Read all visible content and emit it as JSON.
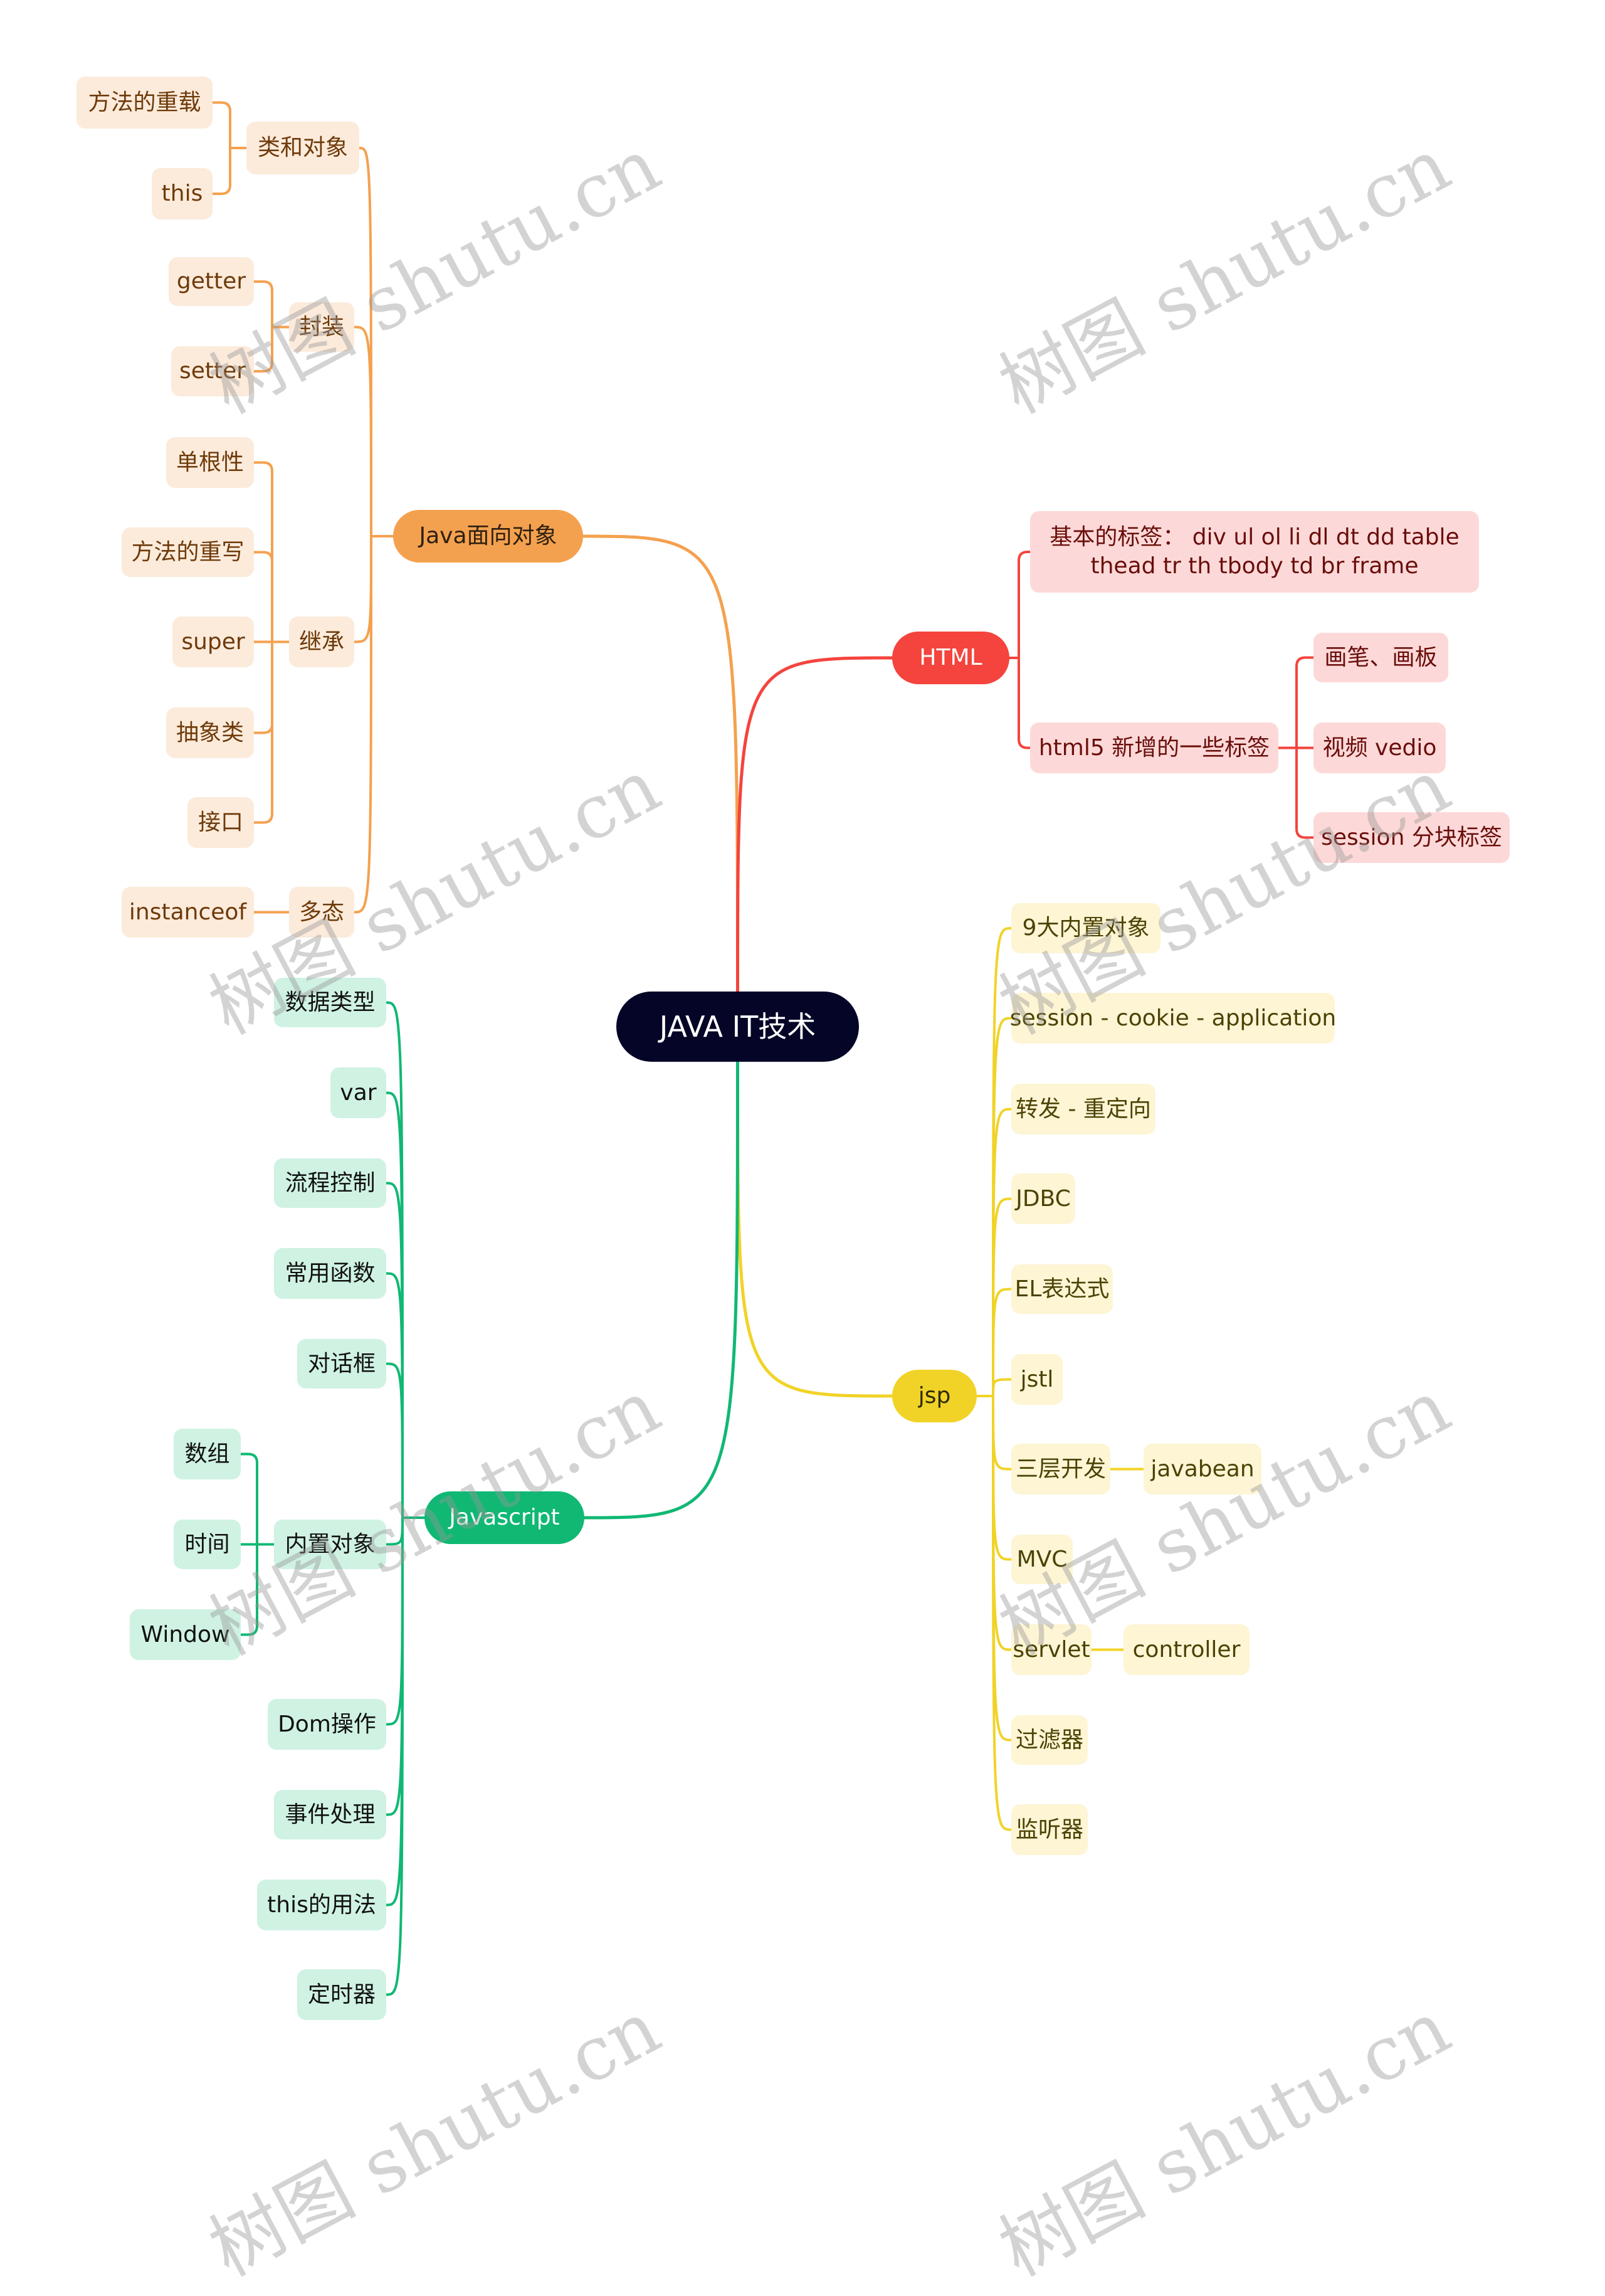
{
  "root": {
    "label": "JAVA IT技术"
  },
  "colors": {
    "root_bg": "#050527",
    "orange": "#f4a14f",
    "red": "#f4443d",
    "yellow": "#f1d327",
    "green": "#10b874"
  },
  "branches": {
    "java_oo": {
      "label": "Java面向对象",
      "children": [
        {
          "label": "类和对象",
          "children": [
            {
              "label": "方法的重载"
            },
            {
              "label": "this"
            }
          ]
        },
        {
          "label": "封装",
          "children": [
            {
              "label": "getter"
            },
            {
              "label": "setter"
            }
          ]
        },
        {
          "label": "继承",
          "children": [
            {
              "label": "单根性"
            },
            {
              "label": "方法的重写"
            },
            {
              "label": "super"
            },
            {
              "label": "抽象类"
            },
            {
              "label": "接口"
            }
          ]
        },
        {
          "label": "多态",
          "children": [
            {
              "label": "instanceof"
            }
          ]
        }
      ]
    },
    "html": {
      "label": "HTML",
      "children": [
        {
          "label": "基本的标签： div ul ol li dl dt dd table thead tr th tbody td br frame"
        },
        {
          "label": "html5 新增的一些标签",
          "children": [
            {
              "label": "画笔、画板"
            },
            {
              "label": "视频 vedio"
            },
            {
              "label": "session 分块标签"
            }
          ]
        }
      ]
    },
    "jsp": {
      "label": "jsp",
      "children": [
        {
          "label": "9大内置对象"
        },
        {
          "label": "session - cookie - application"
        },
        {
          "label": "转发 - 重定向"
        },
        {
          "label": "JDBC"
        },
        {
          "label": "EL表达式"
        },
        {
          "label": "jstl"
        },
        {
          "label": "三层开发",
          "children": [
            {
              "label": "javabean"
            }
          ]
        },
        {
          "label": "MVC"
        },
        {
          "label": "servlet",
          "children": [
            {
              "label": "controller"
            }
          ]
        },
        {
          "label": "过滤器"
        },
        {
          "label": "监听器"
        }
      ]
    },
    "javascript": {
      "label": "Javascript",
      "children": [
        {
          "label": "数据类型"
        },
        {
          "label": "var"
        },
        {
          "label": "流程控制"
        },
        {
          "label": "常用函数"
        },
        {
          "label": "对话框"
        },
        {
          "label": "内置对象",
          "children": [
            {
              "label": "数组"
            },
            {
              "label": "时间"
            },
            {
              "label": "Window"
            }
          ]
        },
        {
          "label": "Dom操作"
        },
        {
          "label": "事件处理"
        },
        {
          "label": "this的用法"
        },
        {
          "label": "定时器"
        }
      ]
    }
  },
  "watermark": {
    "text": "树图 shutu.cn"
  }
}
